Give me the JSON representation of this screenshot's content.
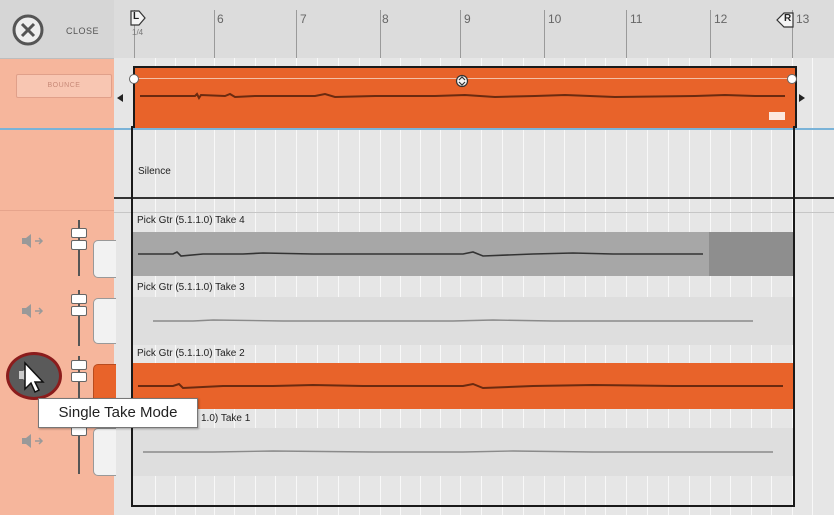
{
  "left_panel": {
    "close_label": "CLOSE",
    "bounce_label": "BOUNCE"
  },
  "ruler": {
    "bars": [
      "6",
      "7",
      "8",
      "9",
      "10",
      "11",
      "12",
      "13"
    ],
    "left_locator": "L",
    "right_locator": "R",
    "sub_label": "1/4"
  },
  "tracks": {
    "silence_label": "Silence",
    "takes": [
      {
        "label": "Pick Gtr (5.1.1.0) Take 4"
      },
      {
        "label": "Pick Gtr (5.1.1.0) Take 3"
      },
      {
        "label": "Pick Gtr (5.1.1.0) Take 2"
      },
      {
        "label": "Pick Gtr (5.1.1.0) Take 1"
      }
    ],
    "take1_visible_suffix": "1.0) Take 1"
  },
  "tooltip": {
    "text": "Single Take Mode"
  },
  "colors": {
    "accent": "#e8632a",
    "panel": "#f6b69c",
    "tooltip_border": "#777777"
  }
}
